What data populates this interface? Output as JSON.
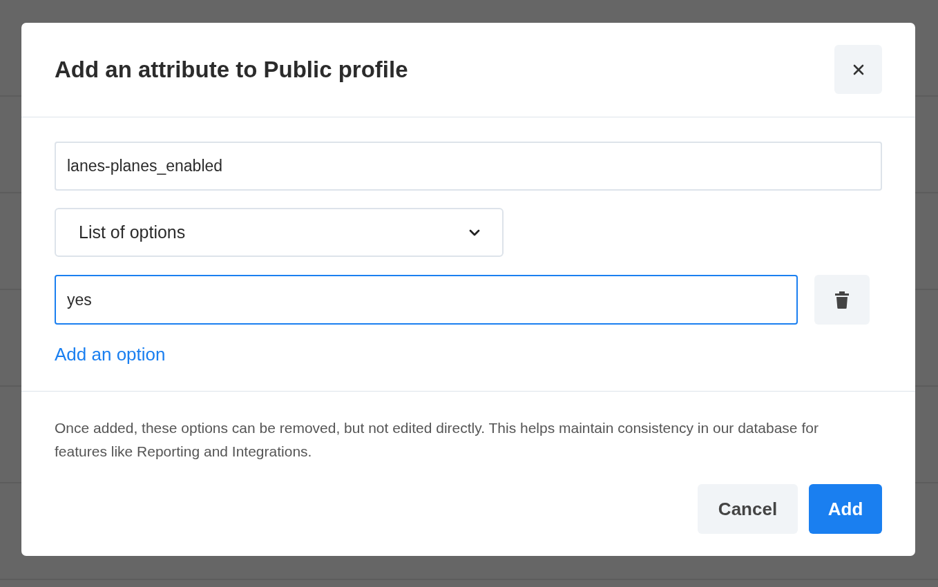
{
  "dialog": {
    "title": "Add an attribute to Public profile",
    "name_field": {
      "value": "lanes-planes_enabled"
    },
    "type_select": {
      "value": "List of options"
    },
    "options": [
      {
        "value": "yes",
        "focused": true
      }
    ],
    "add_option_link": "Add an option",
    "note": "Once added, these options can be removed, but not edited directly. This helps maintain consistency in our database for features like Reporting and Integrations.",
    "buttons": [
      {
        "label": "Cancel",
        "kind": "secondary"
      },
      {
        "label": "Add",
        "kind": "primary"
      }
    ]
  }
}
